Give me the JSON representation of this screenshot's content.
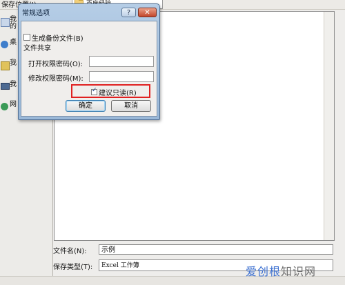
{
  "save_in": {
    "label": "保存位置(I):",
    "value": "百度经验"
  },
  "places": [
    {
      "label": "我\n的"
    },
    {
      "label": "桌"
    },
    {
      "label": "我"
    },
    {
      "label": "我"
    },
    {
      "label": "网"
    }
  ],
  "dialog": {
    "title": "常规选项",
    "help_label": "?",
    "close_label": "✕",
    "backup_label": "生成备份文件(B)",
    "backup_checked": false,
    "share_heading": "文件共享",
    "open_password_label": "打开权限密码(O):",
    "modify_password_label": "修改权限密码(M):",
    "readonly_label": "建议只读(R)",
    "readonly_checked": true,
    "ok_label": "确定",
    "cancel_label": "取消"
  },
  "file_name": {
    "label": "文件名(N):",
    "value": "示例"
  },
  "file_type": {
    "label": "保存类型(T):",
    "value": "Excel 工作簿"
  },
  "watermark": {
    "part1": "爱创根",
    "part2": "知识网"
  },
  "colors": {
    "highlight": "#e02020",
    "title_bar": "#9ab8d8",
    "close_button": "#c3462b"
  }
}
